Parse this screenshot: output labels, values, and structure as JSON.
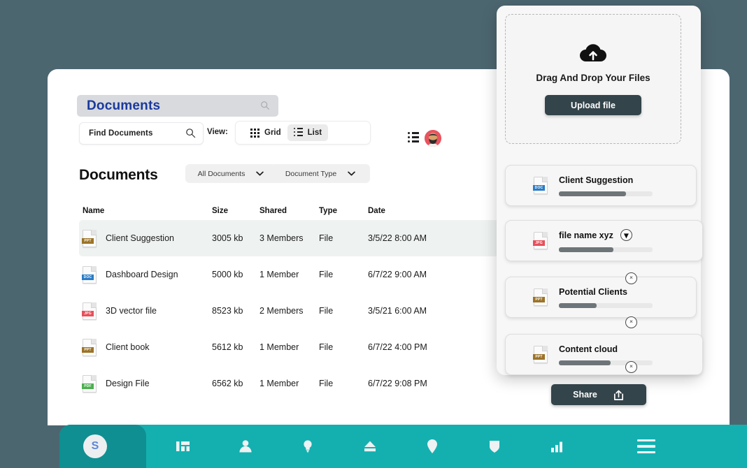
{
  "colors": {
    "page_background": "#4c6670",
    "nav_bar": "#14b0b0",
    "nav_left": "#0f8f91",
    "dark_button": "#33444a",
    "title_text": "#1a3a9e",
    "avatar_bg": "#e8535e"
  },
  "title_bar": {
    "text": "Documents",
    "search_icon": "search-icon"
  },
  "toolbar": {
    "find_value": "Find Documents",
    "find_placeholder": "Find Documents",
    "search_icon": "search-icon",
    "view_label": "View:",
    "grid_label": "Grid",
    "list_label": "List",
    "active_view": "List",
    "header_list_icon": "list-icon",
    "avatar": "user-avatar"
  },
  "documents": {
    "heading": "Documents",
    "filters": [
      {
        "label": "All Documents",
        "icon": "chevron-down-icon"
      },
      {
        "label": "Document Type",
        "icon": "chevron-down-icon"
      }
    ],
    "columns": [
      "Name",
      "Size",
      "Shared",
      "Type",
      "Date"
    ],
    "rows": [
      {
        "name": "Client Suggestion",
        "size": "3005 kb",
        "shared": "3 Members",
        "type": "File",
        "date": "3/5/22 8:00 AM",
        "filetype": "ppt",
        "selected": true
      },
      {
        "name": "Dashboard Design",
        "size": "5000 kb",
        "shared": "1 Member",
        "type": "File",
        "date": "6/7/22 9:00 AM",
        "filetype": "doc",
        "selected": false
      },
      {
        "name": "3D vector file",
        "size": "8523 kb",
        "shared": "2 Members",
        "type": "File",
        "date": "3/5/21 6:00 AM",
        "filetype": "jpg",
        "selected": false
      },
      {
        "name": "Client book",
        "size": "5612 kb",
        "shared": "1 Member",
        "type": "File",
        "date": "6/7/22 4:00 PM",
        "filetype": "ppt",
        "selected": false
      },
      {
        "name": "Design File",
        "size": "6562 kb",
        "shared": "1 Member",
        "type": "File",
        "date": "6/7/22 9:08 PM",
        "filetype": "pdf",
        "selected": false
      }
    ]
  },
  "upload_panel": {
    "dropzone": {
      "icon": "cloud-upload-icon",
      "title": "Drag And Drop Your Files",
      "button_label": "Upload file"
    },
    "queue": [
      {
        "name": "Client Suggestion",
        "filetype": "doc",
        "progress": 72,
        "has_dropdown": false,
        "close_icon": false
      },
      {
        "name": "file name xyz",
        "filetype": "jpg",
        "progress": 58,
        "has_dropdown": true,
        "close_icon": false
      },
      {
        "name": "Potential Clients",
        "filetype": "ppt",
        "progress": 40,
        "has_dropdown": false,
        "close_icon": true
      },
      {
        "name": "Content cloud",
        "filetype": "ppt",
        "progress": 55,
        "has_dropdown": false,
        "close_icon": true
      }
    ],
    "close_icon_name": "close-icon",
    "close_icon_glyph": "×",
    "dropdown_icon_glyph": "▾"
  },
  "share": {
    "label": "Share",
    "icon": "share-icon"
  },
  "bottom_nav": {
    "logo": "S",
    "items": [
      {
        "icon": "dashboard-icon",
        "name": "nav-dashboard"
      },
      {
        "icon": "user-icon",
        "name": "nav-users"
      },
      {
        "icon": "lightbulb-icon",
        "name": "nav-ideas"
      },
      {
        "icon": "upload-icon",
        "name": "nav-upload"
      },
      {
        "icon": "location-pin-icon",
        "name": "nav-location"
      },
      {
        "icon": "shield-icon",
        "name": "nav-security"
      },
      {
        "icon": "bar-chart-icon",
        "name": "nav-analytics"
      }
    ],
    "menu_icon": "hamburger-menu-icon"
  }
}
